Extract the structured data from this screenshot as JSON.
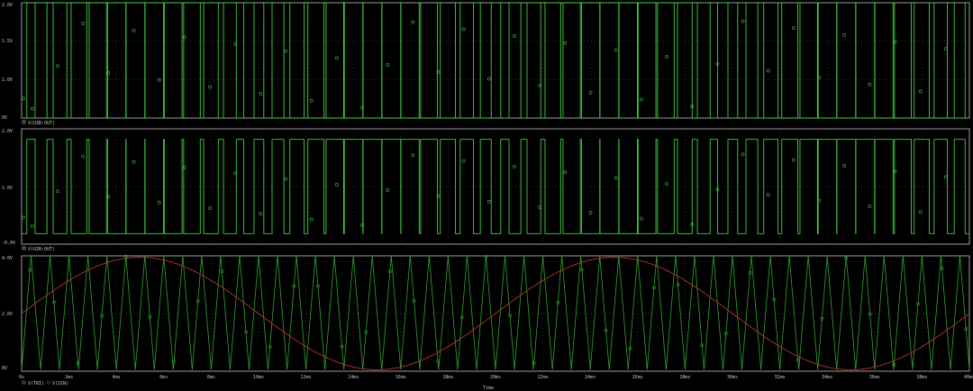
{
  "colors": {
    "background": "#000000",
    "frame": "#9a9a9a",
    "grid": "#5a5a5a",
    "pwm_trace": "#3fd23f",
    "triangle_trace": "#2fa52f",
    "sine_trace": "#b8322e",
    "text": "#c8c8c8"
  },
  "x_axis": {
    "label": "Time",
    "ticks": [
      "0s",
      "2ms",
      "4ms",
      "6ms",
      "8ms",
      "10ms",
      "12ms",
      "14ms",
      "16ms",
      "18ms",
      "20ms",
      "22ms",
      "24ms",
      "26ms",
      "28ms",
      "30ms",
      "32ms",
      "34ms",
      "36ms",
      "38ms",
      "40ms"
    ]
  },
  "panels": {
    "top": {
      "y_ticks": [
        "2.0V",
        "1.5V",
        "1.0V",
        "0.5V",
        "0V"
      ],
      "legend": "V(U3B:OUT)"
    },
    "middle": {
      "y_ticks": [
        "2.0V",
        "1.0V",
        "-0.0V"
      ],
      "legend": "V(U2B:OUT)"
    },
    "bottom": {
      "y_ticks": [
        "4.0V",
        "2.0V",
        "0V"
      ],
      "legend_items": [
        "V(TRI)",
        "V(SIN)"
      ]
    }
  },
  "chart_data": [
    {
      "type": "line",
      "xlabel": "",
      "ylabel": "",
      "xlim": [
        0,
        40
      ],
      "ylim": [
        0,
        2.0
      ],
      "series": [
        {
          "name": "V(U3B:OUT)",
          "values": [
            0,
            2.0
          ],
          "description_of_shape": "PWM pulse train switching between 0V and ~2.0V"
        }
      ]
    },
    {
      "type": "line",
      "xlabel": "",
      "ylabel": "",
      "xlim": [
        0,
        40
      ],
      "ylim": [
        -0.2,
        2.0
      ],
      "series": [
        {
          "name": "V(U2B:OUT)",
          "values": [
            0,
            1.8
          ],
          "description_of_shape": "PWM pulse train switching between ~0V and ~1.8V"
        }
      ]
    },
    {
      "type": "line",
      "xlabel": "Time",
      "ylabel": "",
      "xlim": [
        0,
        40
      ],
      "ylim": [
        0,
        4.0
      ],
      "series": [
        {
          "name": "V(TRI)",
          "period_ms": 0.8,
          "min": 0.05,
          "max": 4.0
        },
        {
          "name": "V(SIN)",
          "period_ms": 20,
          "min": 0.05,
          "max": 4.0,
          "offset": 2.0,
          "amplitude": 1.95
        }
      ]
    }
  ]
}
